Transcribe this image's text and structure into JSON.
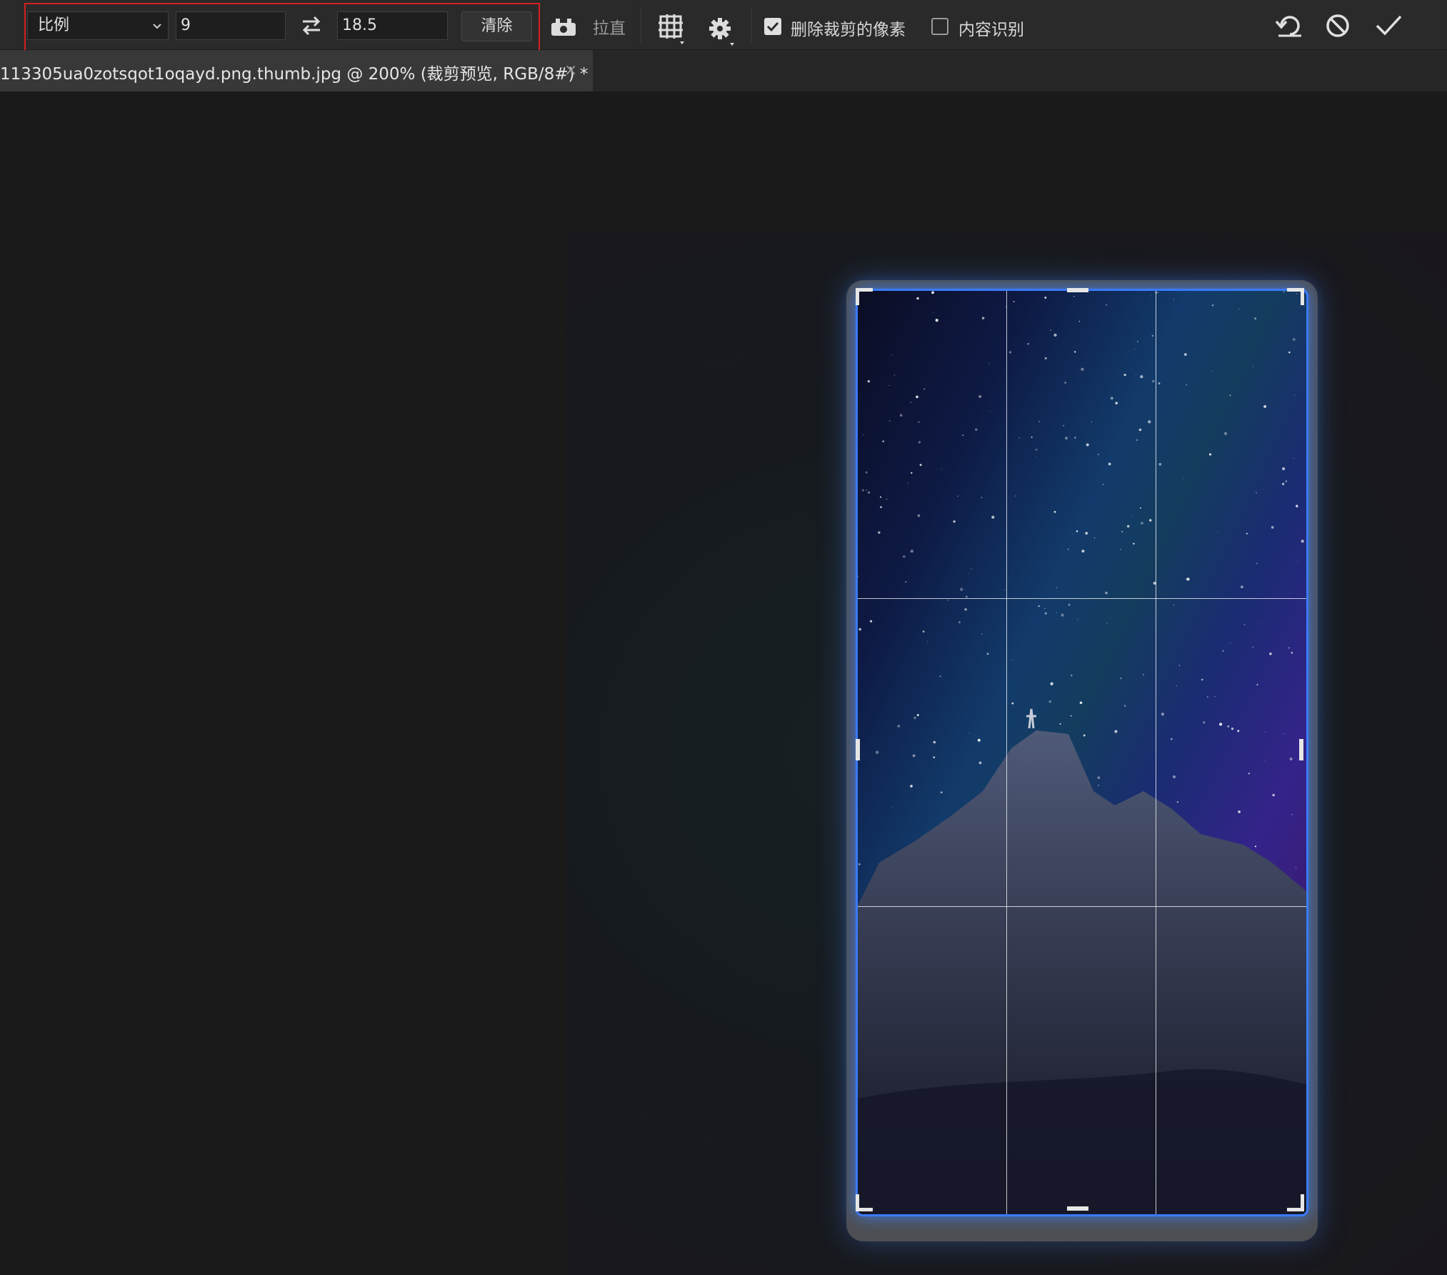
{
  "toolbar": {
    "preset_label": "比例",
    "width_value": "9",
    "height_value": "18.5",
    "clear_label": "清除",
    "straighten_label": "拉直",
    "delete_cropped_label": "删除裁剪的像素",
    "delete_cropped_checked": true,
    "content_aware_label": "内容识别",
    "content_aware_checked": false,
    "highlight_color": "#d32020"
  },
  "document": {
    "tab_title": "113305ua0zotsqot1oqayd.png.thumb.jpg  @  200% (裁剪预览, RGB/8#) *",
    "close_glyph": "×"
  },
  "icons": {
    "preset_dropdown": "chevron-down-icon",
    "swap": "swap-arrows-icon",
    "straighten": "straighten-level-icon",
    "overlay": "grid-overlay-icon",
    "settings": "gear-icon",
    "reset": "reset-undo-icon",
    "cancel": "cancel-circle-icon",
    "commit": "checkmark-icon"
  },
  "colors": {
    "crop_border": "#3a7bff",
    "toolbar_bg": "#2a2a2a",
    "canvas_bg": "#1a1a1a"
  }
}
